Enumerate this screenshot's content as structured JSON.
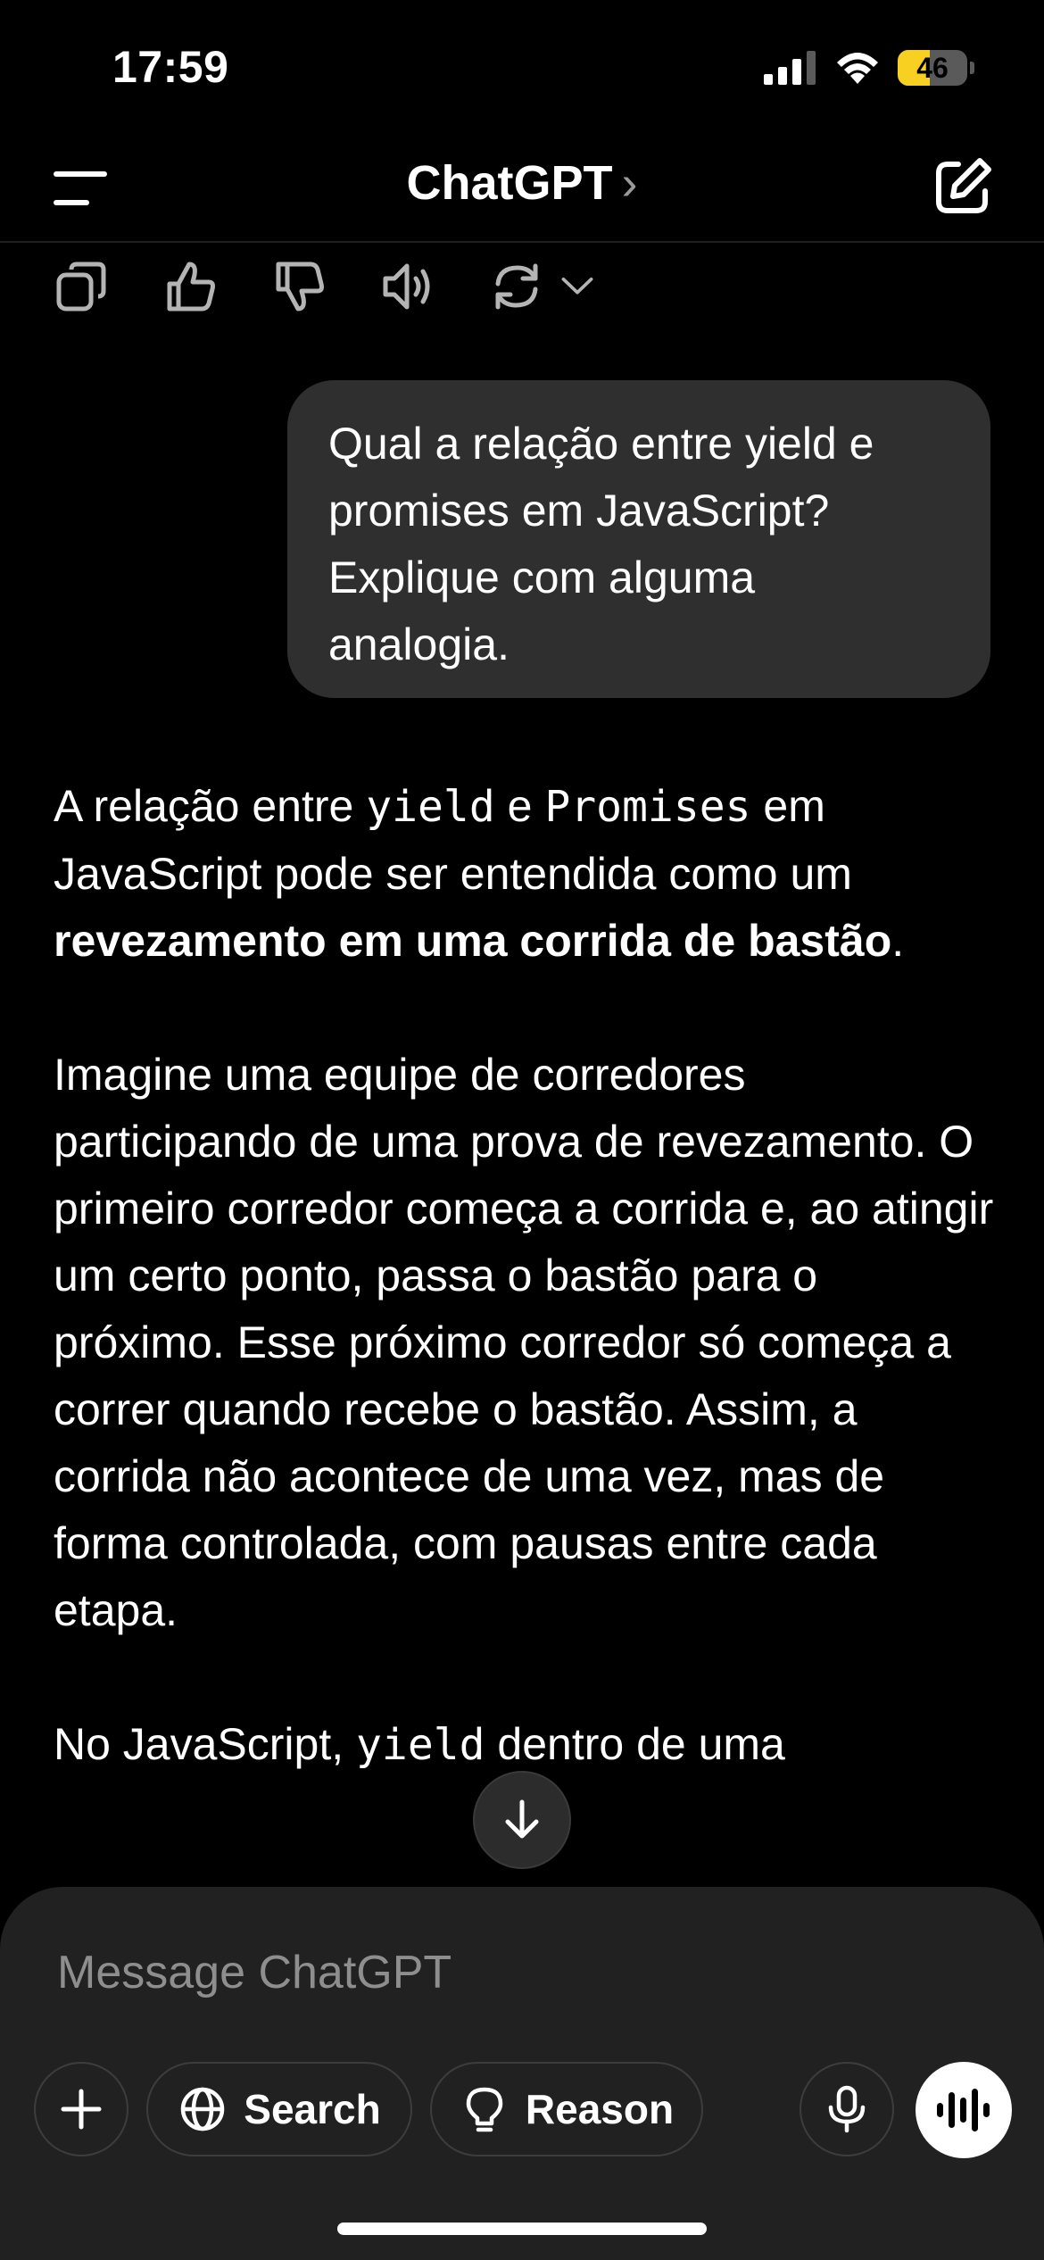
{
  "status_bar": {
    "time": "17:59",
    "battery_level": "46",
    "battery_fraction": 0.46
  },
  "header": {
    "title": "ChatGPT",
    "title_chevron": "›"
  },
  "conversation": {
    "user_message": "Qual a relação entre yield e promises em JavaScript? Explique com alguma analogia.",
    "assistant": {
      "p1_text1": "A relação entre ",
      "p1_code1": "yield",
      "p1_text2": " e ",
      "p1_code2": "Promises",
      "p1_text3": " em JavaScript pode ser entendida como um ",
      "p1_bold": "revezamento em uma corrida de bastão",
      "p1_text4": ".",
      "p2": "Imagine uma equipe de corredores participando de uma prova de revezamento. O primeiro corredor começa a corrida e, ao atingir um certo ponto, passa o bastão para o próximo. Esse próximo corredor só começa a correr quando recebe o bastão. Assim, a corrida não acontece de uma vez, mas de forma controlada, com pausas entre cada etapa.",
      "p3_text1": "No JavaScript, ",
      "p3_code1": "yield",
      "p3_text2": " dentro de uma"
    }
  },
  "composer": {
    "placeholder": "Message ChatGPT",
    "search_label": "Search",
    "reason_label": "Reason"
  },
  "colors": {
    "background": "#000000",
    "bubble": "#2f2f2f",
    "composer": "#212121",
    "battery": "#f7d021"
  }
}
